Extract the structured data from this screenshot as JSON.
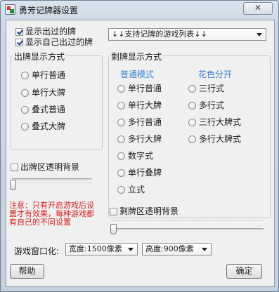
{
  "window": {
    "title": "勇芳记牌器设置",
    "close_glyph": "ꕤ"
  },
  "top": {
    "show_played_label": "显示出过的牌",
    "show_played_checked": true,
    "show_own_played_label": "显示自己出过的牌",
    "show_own_played_checked": true,
    "games_dropdown_value": "↓↓支持记牌的游戏列表↓↓"
  },
  "played_display": {
    "group_label": "出牌显示方式",
    "options": [
      "单行普通",
      "单行大牌",
      "叠式普通",
      "叠式大牌"
    ]
  },
  "remaining_display": {
    "group_label": "剩牌显示方式",
    "normal_mode_header": "普通模式",
    "suit_mode_header": "花色分开",
    "normal_options": [
      "单行普通",
      "单行大牌",
      "多行普通",
      "多行大牌",
      "数字式",
      "单行叠牌",
      "立式"
    ],
    "suit_options": [
      "三行式",
      "多行式",
      "三行大牌式",
      "多行大牌式"
    ]
  },
  "played_area": {
    "transparent_label": "出牌区透明背景",
    "transparent_checked": false
  },
  "remaining_area": {
    "transparent_label": "剩牌区透明背景",
    "transparent_checked": false
  },
  "notice": {
    "lines": [
      "注意：只有开启游戏后设",
      "置才有效果，每种游戏都",
      "有自己的不同设置"
    ]
  },
  "window_size": {
    "label": "游戏窗口化:",
    "width_value": "宽度:1500像素",
    "height_value": "高度:900像素"
  },
  "buttons": {
    "help": "帮助",
    "ok": "确定"
  }
}
